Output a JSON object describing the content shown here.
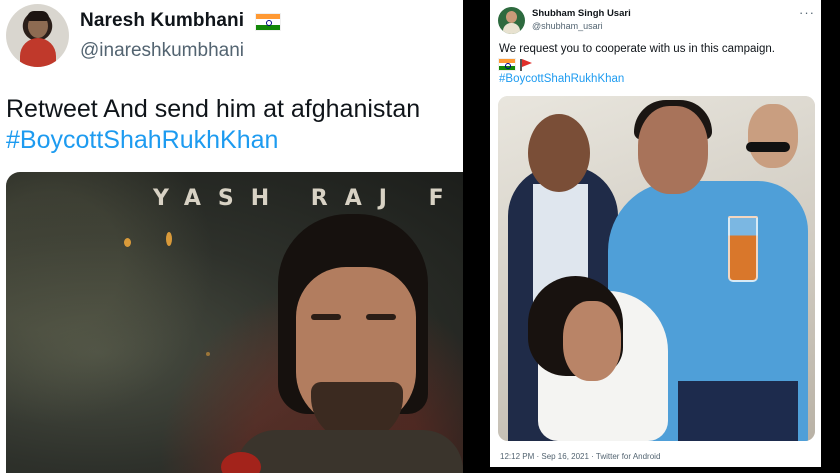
{
  "left_tweet": {
    "author_name": "Naresh Kumbhani",
    "author_handle": "@inareshkumbhani",
    "text": "Retweet And send him at afghanistan",
    "hashtag": "#BoycottShahRukhKhan",
    "media_overlay_text": "YASH RAJ F"
  },
  "right_tweet": {
    "author_name": "Shubham Singh Usari",
    "author_handle": "@shubham_usari",
    "more_label": "···",
    "text": "We request you to cooperate with us in this campaign.",
    "hashtag": "#BoycottShahRukhKhan",
    "timestamp": "12:12 PM · Sep 16, 2021 · Twitter for Android"
  },
  "icons": {
    "flag": "india-flag-icon",
    "red_flag": "red-flag-icon"
  },
  "colors": {
    "hashtag": "#1d9bf0",
    "text": "#0f1419",
    "secondary": "#536471",
    "background": "#000000"
  }
}
